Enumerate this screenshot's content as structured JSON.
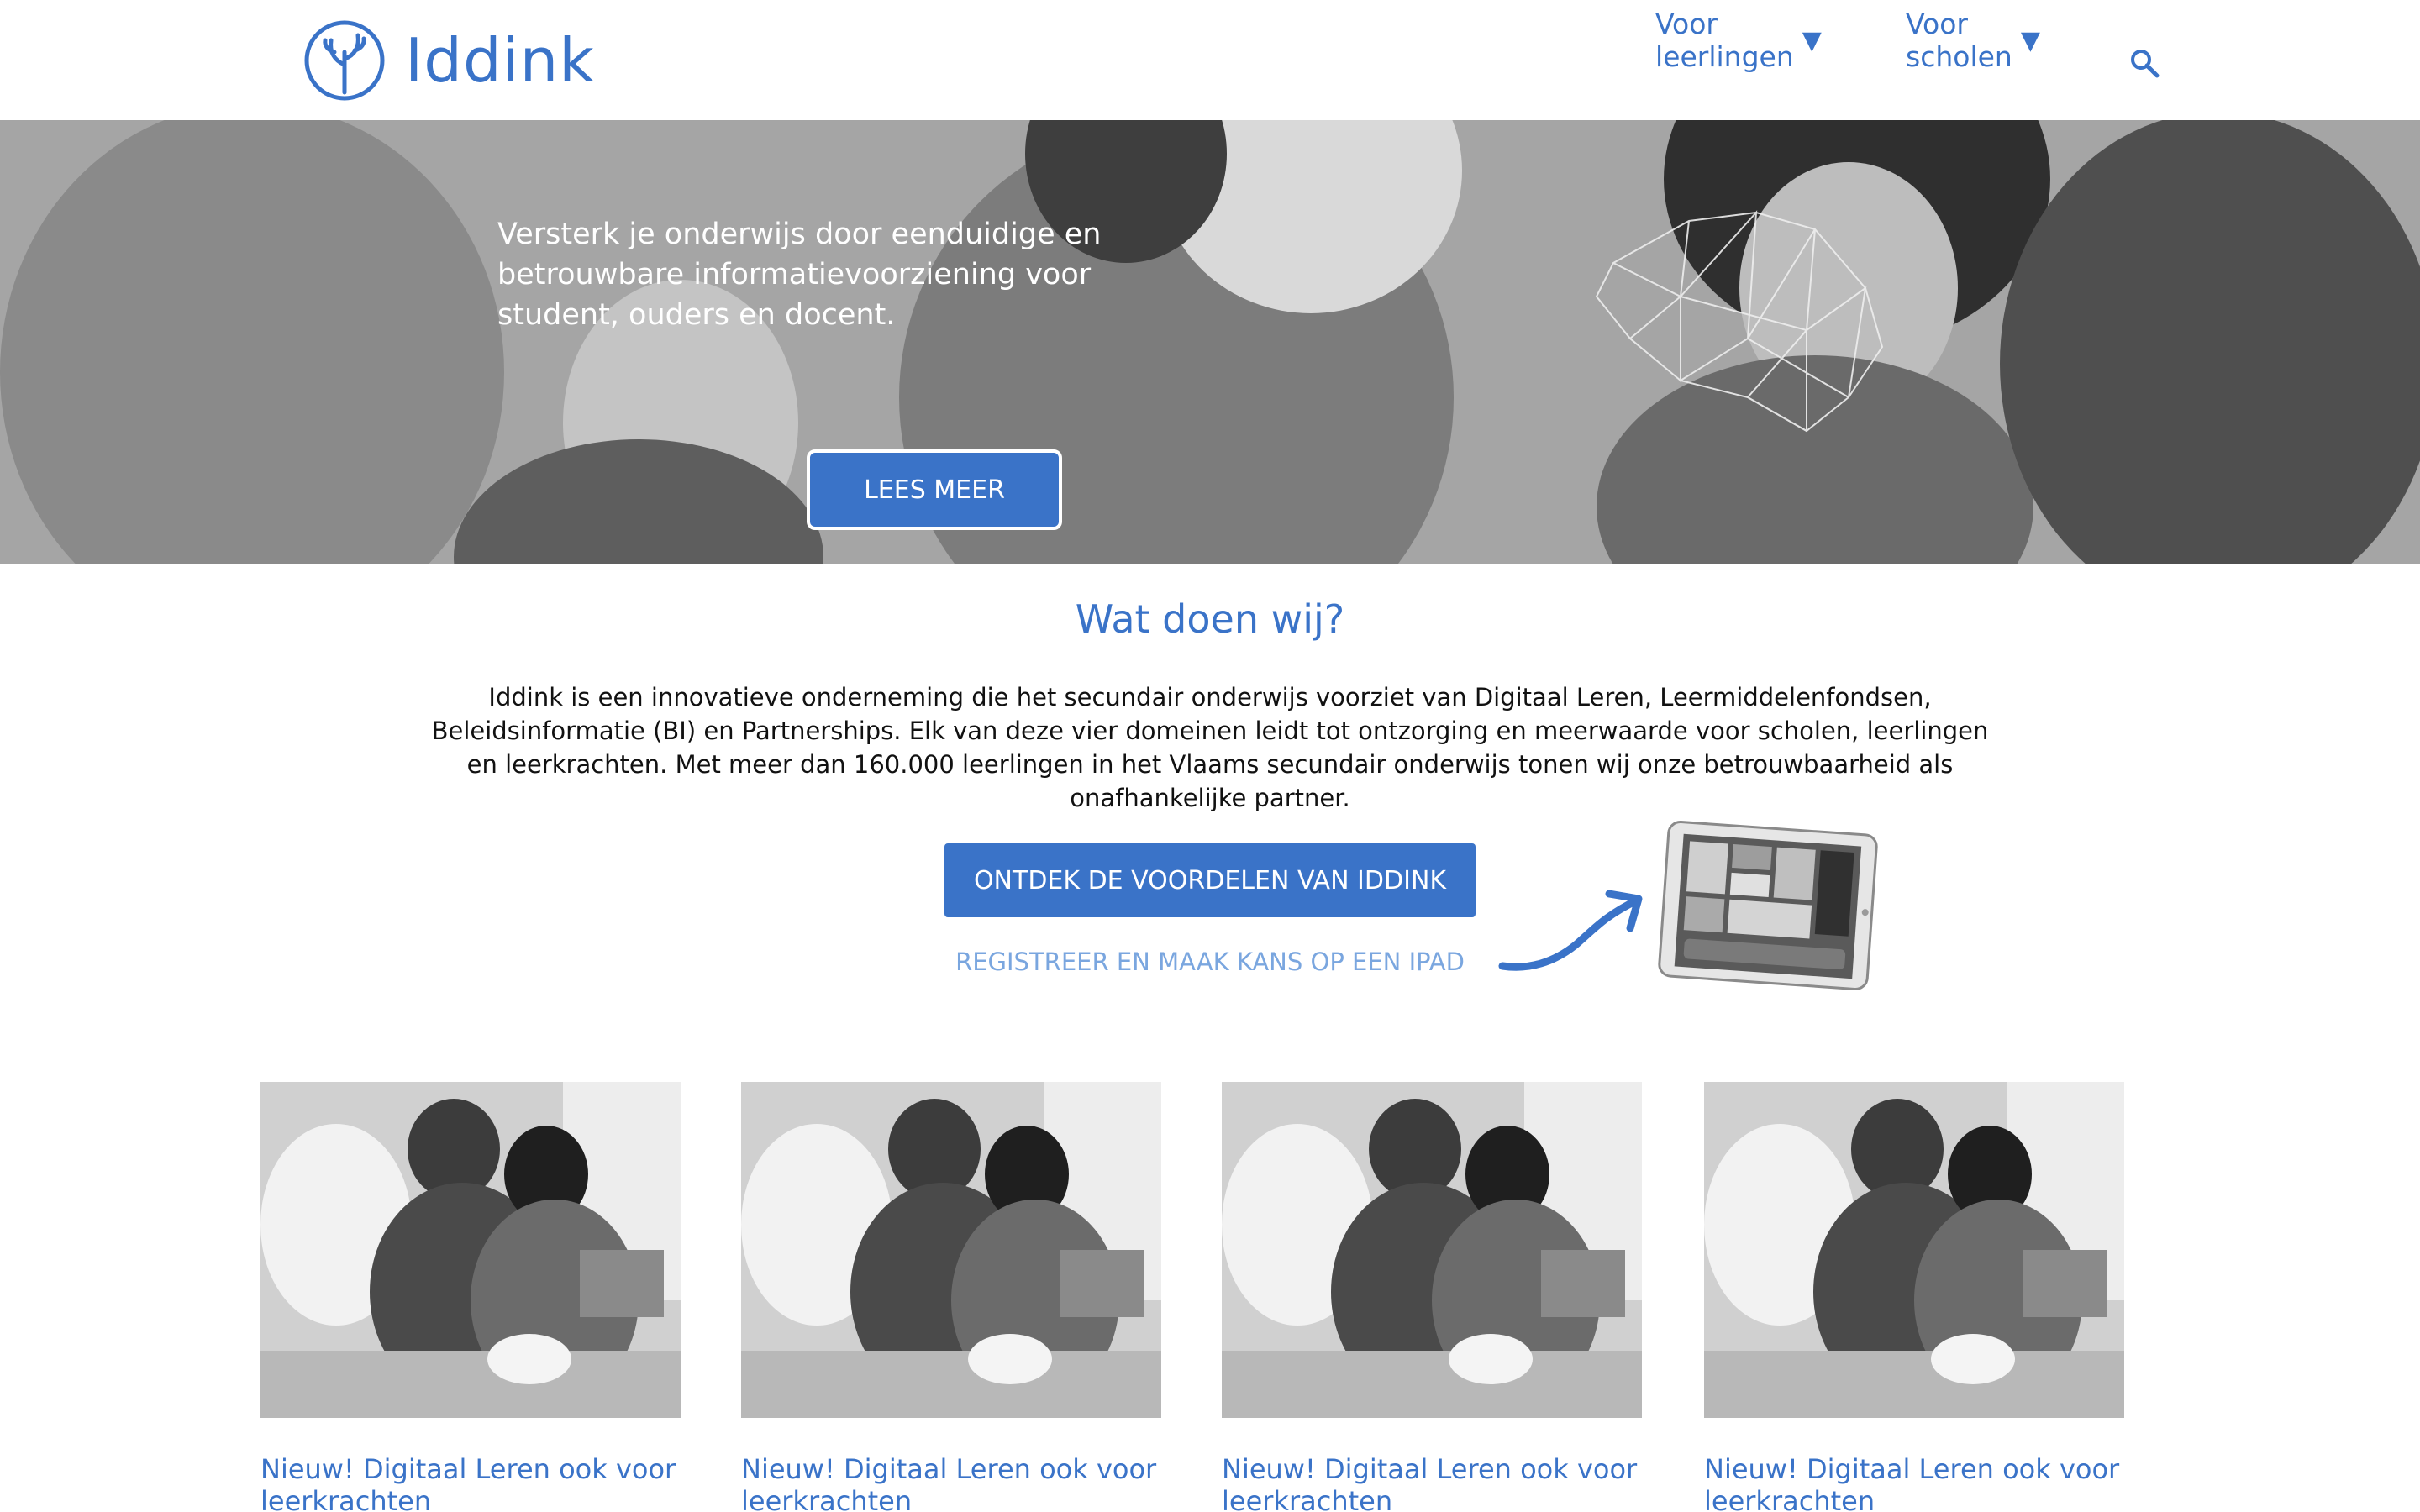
{
  "brand": {
    "name": "Iddink",
    "color": "#3a73c8"
  },
  "nav": {
    "items": [
      {
        "label": "Voor leerlingen",
        "caret": "▼"
      },
      {
        "label": "Voor scholen",
        "caret": "▼"
      }
    ],
    "search_icon": "search-icon"
  },
  "hero": {
    "text": "Versterk je onderwijs door eenduidige en betrouwbare informatievoorziening voor student, ouders en docent.",
    "button_label": "LEES MEER"
  },
  "about": {
    "title": "Wat doen wij?",
    "body": "Iddink is een innovatieve onderneming die het secundair onderwijs voorziet van Digitaal Leren, Leermiddelenfondsen, Beleidsinformatie (BI) en Partnerships. Elk van deze vier domeinen leidt tot ontzorging en meerwaarde voor scholen, leerlingen en leerkrachten. Met meer dan 160.000 leerlingen in het Vlaams secundair onderwijs tonen wij onze betrouwbaarheid als onafhankelijke partner.",
    "cta_label": "ONTDEK DE VOORDELEN VAN IDDINK",
    "register_label": "REGISTREER EN MAAK KANS OP EEN IPAD"
  },
  "cards": [
    {
      "title": "Nieuw! Digitaal Leren ook voor leerkrachten"
    },
    {
      "title": "Nieuw! Digitaal Leren ook voor leerkrachten"
    },
    {
      "title": "Nieuw! Digitaal Leren ook voor leerkrachten"
    },
    {
      "title": "Nieuw! Digitaal Leren ook voor leerkrachten"
    }
  ]
}
